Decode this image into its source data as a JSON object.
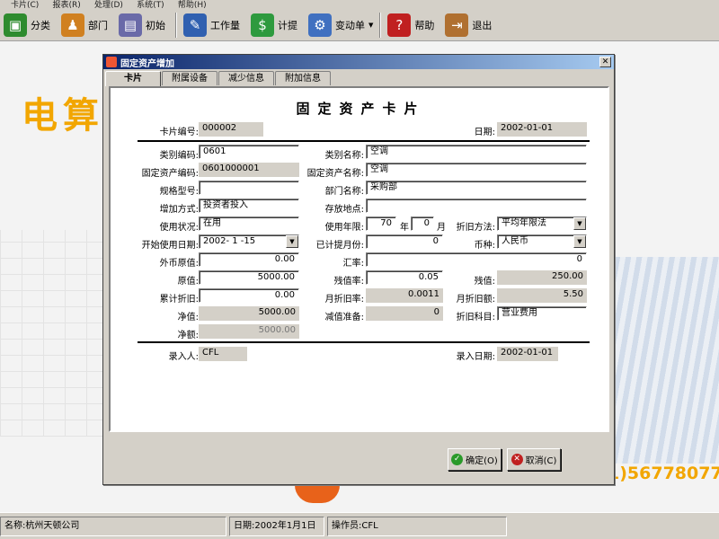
{
  "menu": [
    "卡片(C)",
    "报表(R)",
    "处理(D)",
    "系统(T)",
    "帮助(H)"
  ],
  "toolbar": [
    {
      "label": "分类",
      "icon": "classify-icon",
      "color": "#2e8b2e",
      "glyph": "▣"
    },
    {
      "label": "部门",
      "icon": "department-icon",
      "color": "#d08020",
      "glyph": "♟"
    },
    {
      "label": "初始",
      "icon": "init-icon",
      "color": "#6a6aa8",
      "glyph": "▤"
    },
    {
      "label": "工作量",
      "icon": "workload-icon",
      "color": "#3060b0",
      "glyph": "✎"
    },
    {
      "label": "计提",
      "icon": "accrue-icon",
      "color": "#2e9a3e",
      "glyph": "$"
    },
    {
      "label": "变动单",
      "icon": "change-order-icon",
      "color": "#4070c0",
      "glyph": "⚙"
    },
    {
      "label": "帮助",
      "icon": "help-icon",
      "color": "#c02020",
      "glyph": "?"
    },
    {
      "label": "退出",
      "icon": "exit-icon",
      "color": "#b07030",
      "glyph": "⇥"
    }
  ],
  "background": {
    "brand_text": "电算",
    "phone_text": "1)56778077"
  },
  "dialog": {
    "title": "固定资产增加",
    "tabs": [
      "卡片",
      "附属设备",
      "减少信息",
      "附加信息"
    ],
    "card_title": "固定资产卡片",
    "fields": {
      "card_no": {
        "label": "卡片编号:",
        "value": "000002"
      },
      "date": {
        "label": "日期:",
        "value": "2002-01-01"
      },
      "category_code": {
        "label": "类别编码:",
        "value": "0601"
      },
      "category_name": {
        "label": "类别名称:",
        "value": "空调"
      },
      "asset_code": {
        "label": "固定资产编码:",
        "value": "0601000001"
      },
      "asset_name": {
        "label": "固定资产名称:",
        "value": "空调"
      },
      "spec": {
        "label": "规格型号:",
        "value": ""
      },
      "department": {
        "label": "部门名称:",
        "value": "采购部"
      },
      "add_method": {
        "label": "增加方式:",
        "value": "投资者投入"
      },
      "location": {
        "label": "存放地点:",
        "value": ""
      },
      "usage_status": {
        "label": "使用状况:",
        "value": "在用"
      },
      "useful_life": {
        "label": "使用年限:",
        "years": "70",
        "year_unit": "年",
        "months": "0",
        "month_unit": "月"
      },
      "dep_method": {
        "label": "折旧方法:",
        "value": "平均年限法"
      },
      "start_date": {
        "label": "开始使用日期:",
        "value": "2002- 1 -15"
      },
      "months_accrued": {
        "label": "已计提月份:",
        "value": "0"
      },
      "currency": {
        "label": "币种:",
        "value": "人民币"
      },
      "foreign_value": {
        "label": "外币原值:",
        "value": "0.00"
      },
      "exchange_rate": {
        "label": "汇率:",
        "value": "0"
      },
      "original_value": {
        "label": "原值:",
        "value": "5000.00"
      },
      "residual_rate": {
        "label": "残值率:",
        "value": "0.05"
      },
      "residual_value": {
        "label": "残值:",
        "value": "250.00"
      },
      "accum_dep": {
        "label": "累计折旧:",
        "value": "0.00"
      },
      "monthly_rate": {
        "label": "月折旧率:",
        "value": "0.0011"
      },
      "monthly_dep": {
        "label": "月折旧额:",
        "value": "5.50"
      },
      "net_value": {
        "label": "净值:",
        "value": "5000.00"
      },
      "impairment": {
        "label": "减值准备:",
        "value": "0"
      },
      "dep_account": {
        "label": "折旧科目:",
        "value": "营业费用"
      },
      "net_amount": {
        "label": "净额:",
        "value": "5000.00"
      },
      "entered_by": {
        "label": "录入人:",
        "value": "CFL"
      },
      "entry_date": {
        "label": "录入日期:",
        "value": "2002-01-01"
      }
    },
    "ok_label": "确定(O)",
    "cancel_label": "取消(C)"
  },
  "status": {
    "company": "名称:杭州天顿公司",
    "date": "日期:2002年1月1日",
    "operator": "操作员:CFL"
  }
}
